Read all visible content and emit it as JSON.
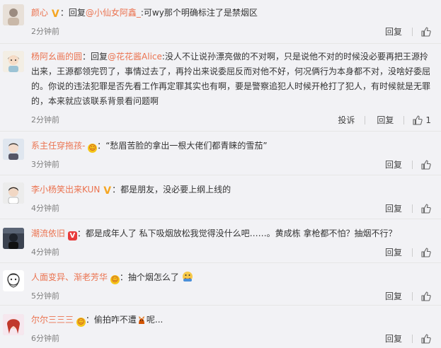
{
  "ui": {
    "reply_label": "回复",
    "report_label": "投诉",
    "like_icon": "thumbs-up-icon"
  },
  "comments": [
    {
      "name": "颜心",
      "badge": "V",
      "prefix": "回复",
      "mention": "@小仙女阿鑫_",
      "text": ":可wy那个明确标注了是禁烟区",
      "time": "2分钟前"
    },
    {
      "name": "杨阿幺画的圆",
      "prefix": "回复",
      "mention": "@花花酱Alice",
      "text": ":没人不让说孙漂亮做的不对啊，只是说他不对的时候没必要再把王源拎出来，王源都领完罚了，事情过去了，再拎出来说委屈反而对他不好，何况俩行为本身都不对，没啥好委屈的。你说的违法犯罪是否先看工作再定罪其实也有啊，要是警察追犯人时候开枪打了犯人，有时候就是无罪的，本来就应该联系背景看问题啊",
      "time": "2分钟前",
      "like_count": "1"
    },
    {
      "name": "系主任穿拖孩-",
      "badge": "fan",
      "text": "“愁眉苦脸的拿出一根大佬们都青睐的雪茄”",
      "time": "3分钟前"
    },
    {
      "name": "李小杨笑出来KUN",
      "badge": "V",
      "text": "都是朋友，没必要上纲上线的",
      "time": "4分钟前"
    },
    {
      "name": "潮流依旧",
      "badge": "VIP",
      "text": "都是成年人了 私下吸烟放松我觉得没什么吧……。黄成栋 拿枪都不怕？抽烟不行？",
      "time": "4分钟前"
    },
    {
      "name": "人面变异、渐老芳华",
      "badge": "fan",
      "text": "抽个烟怎么了",
      "time": "5分钟前"
    },
    {
      "name": "尔尔三三三",
      "badge": "fan",
      "text": "偷拍咋不遭",
      "text_after": "呢...",
      "time": "6分钟前"
    }
  ]
}
